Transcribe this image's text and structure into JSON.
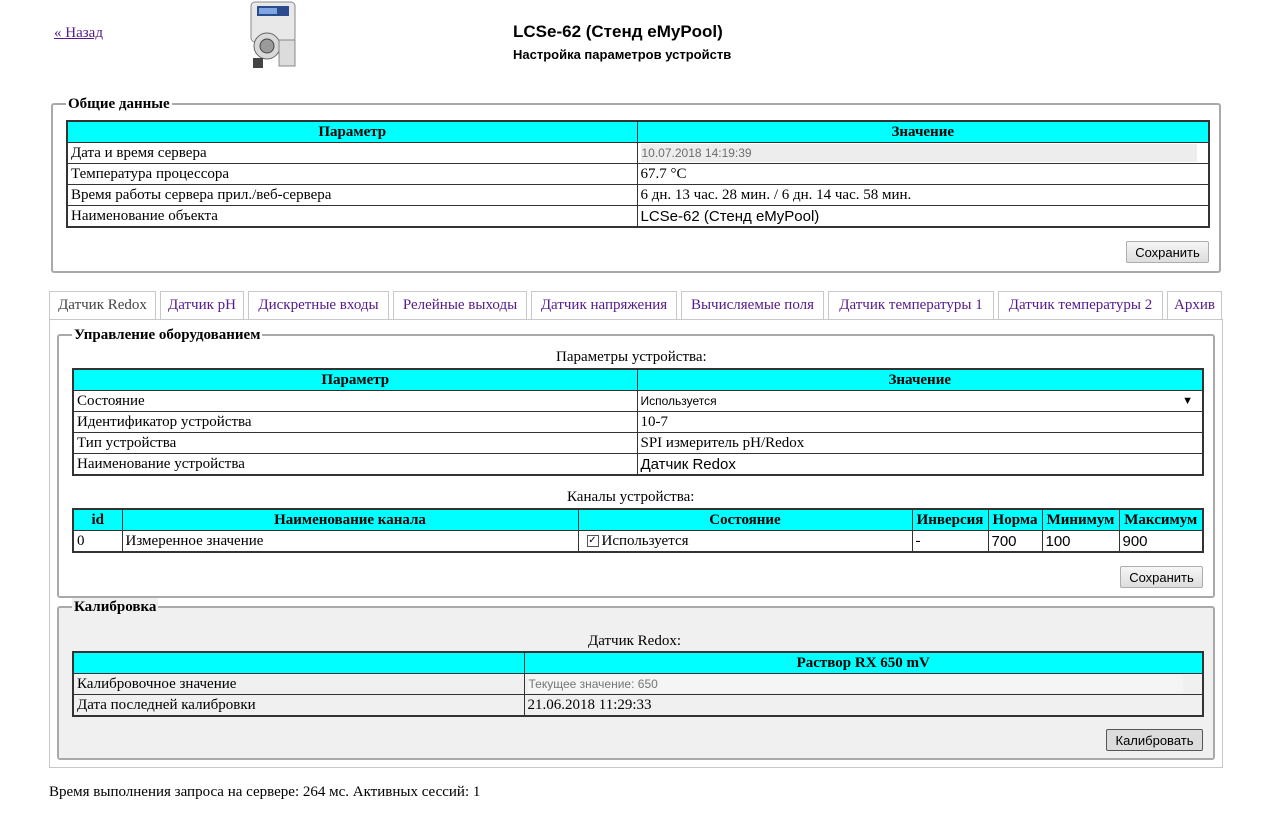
{
  "header": {
    "back_link": "« Назад",
    "title": "LCSe-62 (Стенд eMyPool)",
    "subtitle": "Настройка параметров устройств"
  },
  "general": {
    "legend": "Общие данные",
    "col_param": "Параметр",
    "col_value": "Значение",
    "rows": [
      {
        "param": "Дата и время сервера",
        "value": "10.07.2018 14:19:39"
      },
      {
        "param": "Температура процессора",
        "value": "67.7 °C"
      },
      {
        "param": "Время работы сервера прил./веб-сервера",
        "value": "6 дн. 13 час. 28 мин. / 6 дн. 14 час. 58 мин."
      },
      {
        "param": "Наименование объекта",
        "value": "LCSe-62 (Стенд eMyPool)"
      }
    ],
    "save_label": "Сохранить"
  },
  "tabs": [
    "Датчик Redox",
    "Датчик pH",
    "Дискретные входы",
    "Релейные выходы",
    "Датчик напряжения",
    "Вычисляемые поля",
    "Датчик температуры 1",
    "Датчик температуры 2",
    "Архив"
  ],
  "equipment": {
    "legend": "Управление оборудованием",
    "params_caption": "Параметры устройства:",
    "col_param": "Параметр",
    "col_value": "Значение",
    "rows": [
      {
        "param": "Состояние",
        "value": "Используется"
      },
      {
        "param": "Идентификатор устройства",
        "value": "10-7"
      },
      {
        "param": "Тип устройства",
        "value": "SPI измеритель pH/Redox"
      },
      {
        "param": "Наименование устройства",
        "value": "Датчик Redox"
      }
    ],
    "channels_caption": "Каналы устройства:",
    "channel_headers": [
      "id",
      "Наименование канала",
      "Состояние",
      "Инверсия",
      "Норма",
      "Минимум",
      "Максимум"
    ],
    "channel": {
      "id": "0",
      "name": "Измеренное значение",
      "state": "Используется",
      "inversion": "-",
      "norm": "700",
      "min": "100",
      "max": "900"
    },
    "save_label": "Сохранить"
  },
  "calibration": {
    "legend": "Калибровка",
    "caption": "Датчик Redox:",
    "col_value": "Раствор RX 650 mV",
    "rows": [
      {
        "param": "Калибровочное значение",
        "value": "Текущее значение: 650"
      },
      {
        "param": "Дата последней калибровки",
        "value": "21.06.2018 11:29:33"
      }
    ],
    "calibrate_label": "Калибровать"
  },
  "footer": "Время выполнения запроса на сервере: 264 мс. Активных сессий: 1"
}
